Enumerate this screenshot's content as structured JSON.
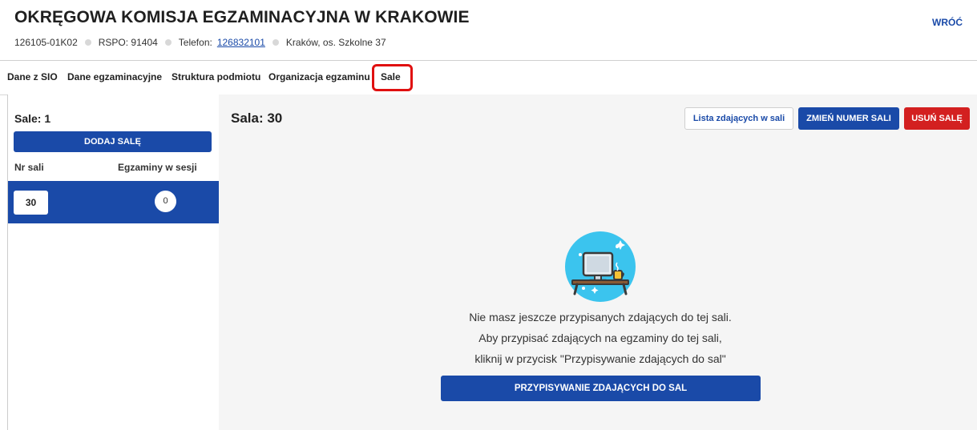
{
  "header": {
    "title": "OKRĘGOWA KOMISJA EGZAMINACYJNA W KRAKOWIE",
    "back_label": "WRÓĆ",
    "code": "126105-01K02",
    "rspo": "RSPO: 91404",
    "phone_label": "Telefon:",
    "phone_number": "126832101",
    "address": "Kraków, os. Szkolne 37"
  },
  "tabs": [
    "Dane z SIO",
    "Dane egzaminacyjne",
    "Struktura podmiotu",
    "Organizacja egzaminu",
    "Sale"
  ],
  "active_tab": "Sale",
  "sidebar": {
    "title": "Sale: 1",
    "add_button": "DODAJ SALĘ",
    "col_room": "Nr sali",
    "col_exams": "Egzaminy w sesji",
    "rows": [
      {
        "room": "30",
        "exams": "0"
      }
    ]
  },
  "main": {
    "title": "Sala: 30",
    "btn_list": "Lista zdających w sali",
    "btn_rename": "ZMIEŃ NUMER SALI",
    "btn_delete": "USUŃ SALĘ",
    "empty_line1": "Nie masz jeszcze przypisanych zdających do tej sali.",
    "empty_line2": "Aby przypisać zdających na egzaminy do tej sali,",
    "empty_line3": "kliknij w przycisk \"Przypisywanie zdających do sal\"",
    "assign_button": "PRZYPISYWANIE ZDAJĄCYCH DO SAL"
  },
  "colors": {
    "primary": "#1a4aa8",
    "danger": "#d32020",
    "highlight": "#e01010"
  },
  "icons": [
    "empty-desk-illustration"
  ]
}
